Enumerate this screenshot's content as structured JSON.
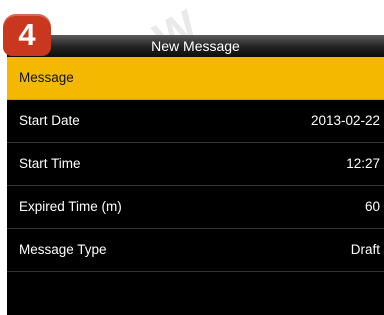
{
  "badge": {
    "step_number": "4"
  },
  "window": {
    "title": "New Message"
  },
  "menu": {
    "items": [
      {
        "label": "Message",
        "value": ""
      },
      {
        "label": "Start Date",
        "value": "2013-02-22"
      },
      {
        "label": "Start Time",
        "value": "12:27"
      },
      {
        "label": "Expired Time (m)",
        "value": "60"
      },
      {
        "label": "Message Type",
        "value": "Draft"
      }
    ],
    "selected_index": 0
  },
  "colors": {
    "highlight": "#f5b800",
    "screen_background": "#000000",
    "badge_background": "#c9381e"
  }
}
